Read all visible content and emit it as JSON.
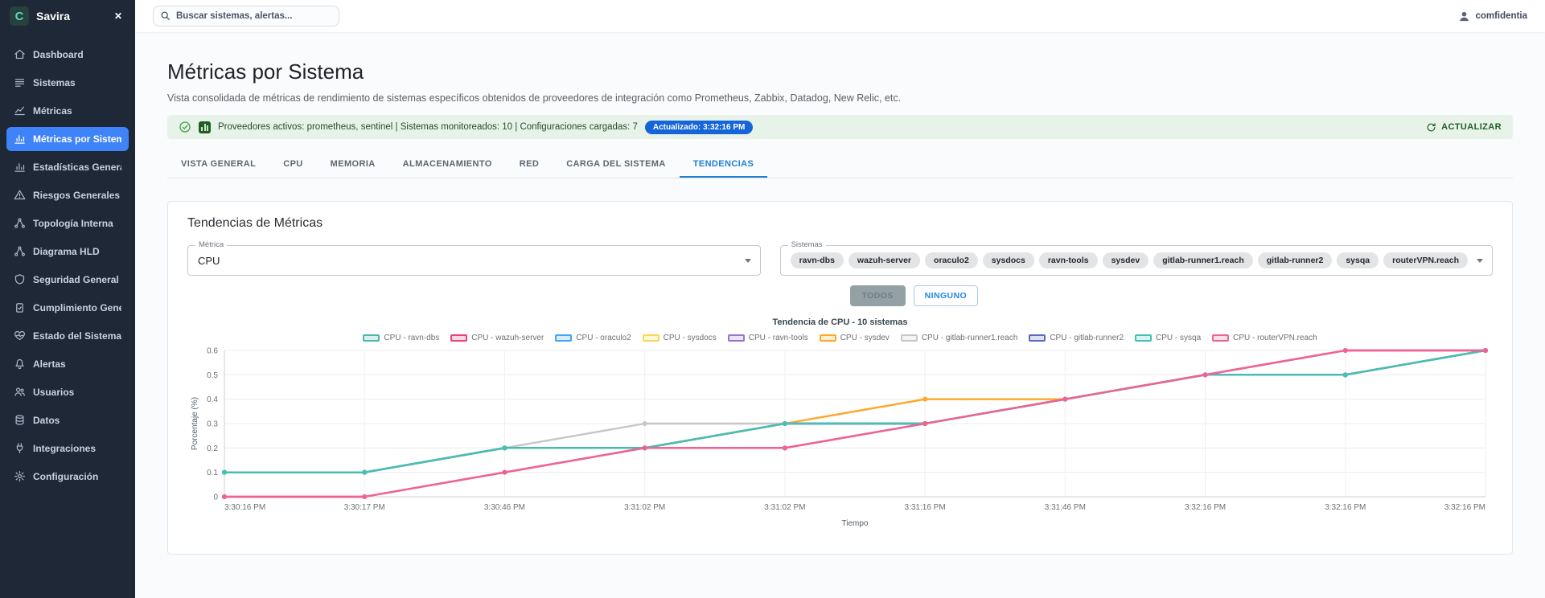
{
  "icons": {
    "close": "✕"
  },
  "sidebar": {
    "brand": "Savira",
    "logo_letter": "C",
    "items": [
      {
        "icon": "home",
        "label": "Dashboard",
        "active": false
      },
      {
        "icon": "rows",
        "label": "Sistemas",
        "active": false
      },
      {
        "icon": "chart-line",
        "label": "Métricas",
        "active": false
      },
      {
        "icon": "chart-bar",
        "label": "Métricas por Sistema",
        "active": true
      },
      {
        "icon": "chart-bar",
        "label": "Estadísticas Generales",
        "active": false
      },
      {
        "icon": "warning",
        "label": "Riesgos Generales",
        "active": false
      },
      {
        "icon": "network",
        "label": "Topología Interna",
        "active": false
      },
      {
        "icon": "network",
        "label": "Diagrama HLD",
        "active": false
      },
      {
        "icon": "shield",
        "label": "Seguridad General",
        "active": false
      },
      {
        "icon": "clipboard",
        "label": "Cumplimiento General",
        "active": false
      },
      {
        "icon": "heart-pulse",
        "label": "Estado del Sistema",
        "active": false
      },
      {
        "icon": "bell",
        "label": "Alertas",
        "active": false
      },
      {
        "icon": "users",
        "label": "Usuarios",
        "active": false
      },
      {
        "icon": "database",
        "label": "Datos",
        "active": false
      },
      {
        "icon": "plug",
        "label": "Integraciones",
        "active": false
      },
      {
        "icon": "gear",
        "label": "Configuración",
        "active": false
      }
    ]
  },
  "topbar": {
    "search_placeholder": "Buscar sistemas, alertas...",
    "user": "comfidentia"
  },
  "page": {
    "title": "Métricas por Sistema",
    "subtitle": "Vista consolidada de métricas de rendimiento de sistemas específicos obtenidos de proveedores de integración como Prometheus, Zabbix, Datadog, New Relic, etc.",
    "banner": {
      "text": "Proveedores activos: prometheus, sentinel | Sistemas monitoreados: 10 | Configuraciones cargadas: 7",
      "badge": "Actualizado: 3:32:16 PM",
      "refresh_label": "ACTUALIZAR"
    },
    "tabs": [
      "VISTA GENERAL",
      "CPU",
      "MEMORIA",
      "ALMACENAMIENTO",
      "RED",
      "CARGA DEL SISTEMA",
      "TENDENCIAS"
    ],
    "active_tab": "TENDENCIAS"
  },
  "panel": {
    "title": "Tendencias de Métricas",
    "metric_label": "Métrica",
    "metric_value": "CPU",
    "systems_label": "Sistemas",
    "chips": [
      "ravn-dbs",
      "wazuh-server",
      "oraculo2",
      "sysdocs",
      "ravn-tools",
      "sysdev",
      "gitlab-runner1.reach",
      "gitlab-runner2",
      "sysqa",
      "routerVPN.reach"
    ],
    "buttons": {
      "all": "TODOS",
      "none": "NINGUNO"
    }
  },
  "chart_data": {
    "type": "line",
    "title": "Tendencia de CPU - 10 sistemas",
    "xlabel": "Tiempo",
    "ylabel": "Porcentaje (%)",
    "ylim": [
      0,
      0.6
    ],
    "yticks": [
      0,
      0.1,
      0.2,
      0.3,
      0.4,
      0.5,
      0.6
    ],
    "grid": true,
    "legend_position": "top",
    "x_labels": [
      "3:30:16 PM",
      "3:30:17 PM",
      "3:30:46 PM",
      "3:31:02 PM",
      "3:31:02 PM",
      "3:31:16 PM",
      "3:31:46 PM",
      "3:32:16 PM",
      "3:32:16 PM",
      "3:32:16 PM"
    ],
    "series": [
      {
        "name": "CPU - ravn-dbs",
        "color": "#4db6ac",
        "values": [
          0.1,
          0.1,
          0.2,
          0.2,
          0.3,
          0.3,
          0.4,
          0.5,
          0.5,
          0.6
        ]
      },
      {
        "name": "CPU - wazuh-server",
        "color": "#ec407a",
        "values": [
          0,
          0,
          0.1,
          0.2,
          0.2,
          0.3,
          0.4,
          0.5,
          0.6,
          0.6
        ]
      },
      {
        "name": "CPU - oraculo2",
        "color": "#42a5f5",
        "values": [
          0.1,
          0.1,
          0.2,
          0.2,
          0.3,
          0.3,
          0.4,
          0.5,
          0.5,
          0.6
        ]
      },
      {
        "name": "CPU - sysdocs",
        "color": "#ffd54f",
        "values": [
          0.1,
          0.1,
          0.2,
          0.2,
          0.3,
          0.3,
          0.4,
          0.5,
          0.5,
          0.6
        ]
      },
      {
        "name": "CPU - ravn-tools",
        "color": "#9575cd",
        "values": [
          0.1,
          0.1,
          0.2,
          0.2,
          0.3,
          0.3,
          0.4,
          0.5,
          0.5,
          0.6
        ]
      },
      {
        "name": "CPU - sysdev",
        "color": "#ffa726",
        "values": [
          0.1,
          0.1,
          0.2,
          0.2,
          0.3,
          0.4,
          0.4,
          0.5,
          0.5,
          0.6
        ]
      },
      {
        "name": "CPU - gitlab-runner1.reach",
        "color": "#c7c7c7",
        "values": [
          0.1,
          0.1,
          0.2,
          0.3,
          0.3,
          0.3,
          0.4,
          0.5,
          0.5,
          0.6
        ]
      },
      {
        "name": "CPU - gitlab-runner2",
        "color": "#5c6bc0",
        "values": [
          0.1,
          0.1,
          0.2,
          0.2,
          0.3,
          0.3,
          0.4,
          0.5,
          0.5,
          0.6
        ]
      },
      {
        "name": "CPU - sysqa",
        "color": "#45c0b4",
        "values": [
          0.1,
          0.1,
          0.2,
          0.2,
          0.3,
          0.3,
          0.4,
          0.5,
          0.5,
          0.6
        ]
      },
      {
        "name": "CPU - routerVPN.reach",
        "color": "#f06292",
        "values": [
          0,
          0,
          0.1,
          0.2,
          0.2,
          0.3,
          0.4,
          0.5,
          0.6,
          0.6
        ]
      }
    ]
  }
}
